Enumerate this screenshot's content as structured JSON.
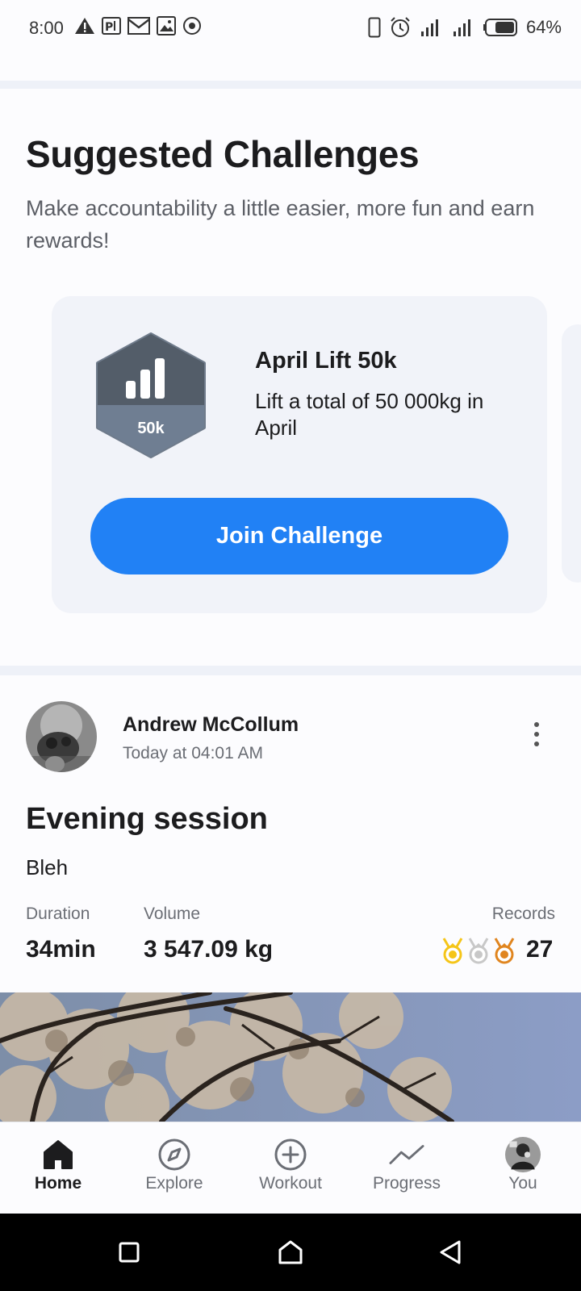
{
  "status_bar": {
    "time": "8:00",
    "battery_percent": "64%",
    "left_icons": [
      "warning-icon",
      "parking-app-icon",
      "gmail-icon",
      "image-icon",
      "record-icon"
    ],
    "right_icons": [
      "phone-icon",
      "alarm-icon",
      "signal-icon",
      "signal-icon",
      "battery-icon"
    ]
  },
  "challenges": {
    "title": "Suggested Challenges",
    "subtitle": "Make accountability a little easier, more fun and earn rewards!",
    "card": {
      "badge_label": "50k",
      "name": "April Lift 50k",
      "description": "Lift a total of 50 000kg in April",
      "button_label": "Join Challenge"
    }
  },
  "post": {
    "user_name": "Andrew McCollum",
    "timestamp": "Today at 04:01 AM",
    "title": "Evening session",
    "description": "Bleh",
    "stats": {
      "duration_label": "Duration",
      "duration_value": "34min",
      "volume_label": "Volume",
      "volume_value": "3 547.09 kg",
      "records_label": "Records",
      "records_value": "27"
    }
  },
  "tabs": [
    {
      "label": "Home",
      "icon": "home-icon",
      "active": true
    },
    {
      "label": "Explore",
      "icon": "compass-icon",
      "active": false
    },
    {
      "label": "Workout",
      "icon": "plus-circle-icon",
      "active": false
    },
    {
      "label": "Progress",
      "icon": "trend-icon",
      "active": false
    },
    {
      "label": "You",
      "icon": "avatar",
      "active": false
    }
  ],
  "colors": {
    "accent": "#2181f5",
    "card_bg": "#f1f3f9",
    "badge": "#4f5863",
    "gold": "#f5c518",
    "silver": "#c8c8c8",
    "bronze": "#e0851f"
  }
}
